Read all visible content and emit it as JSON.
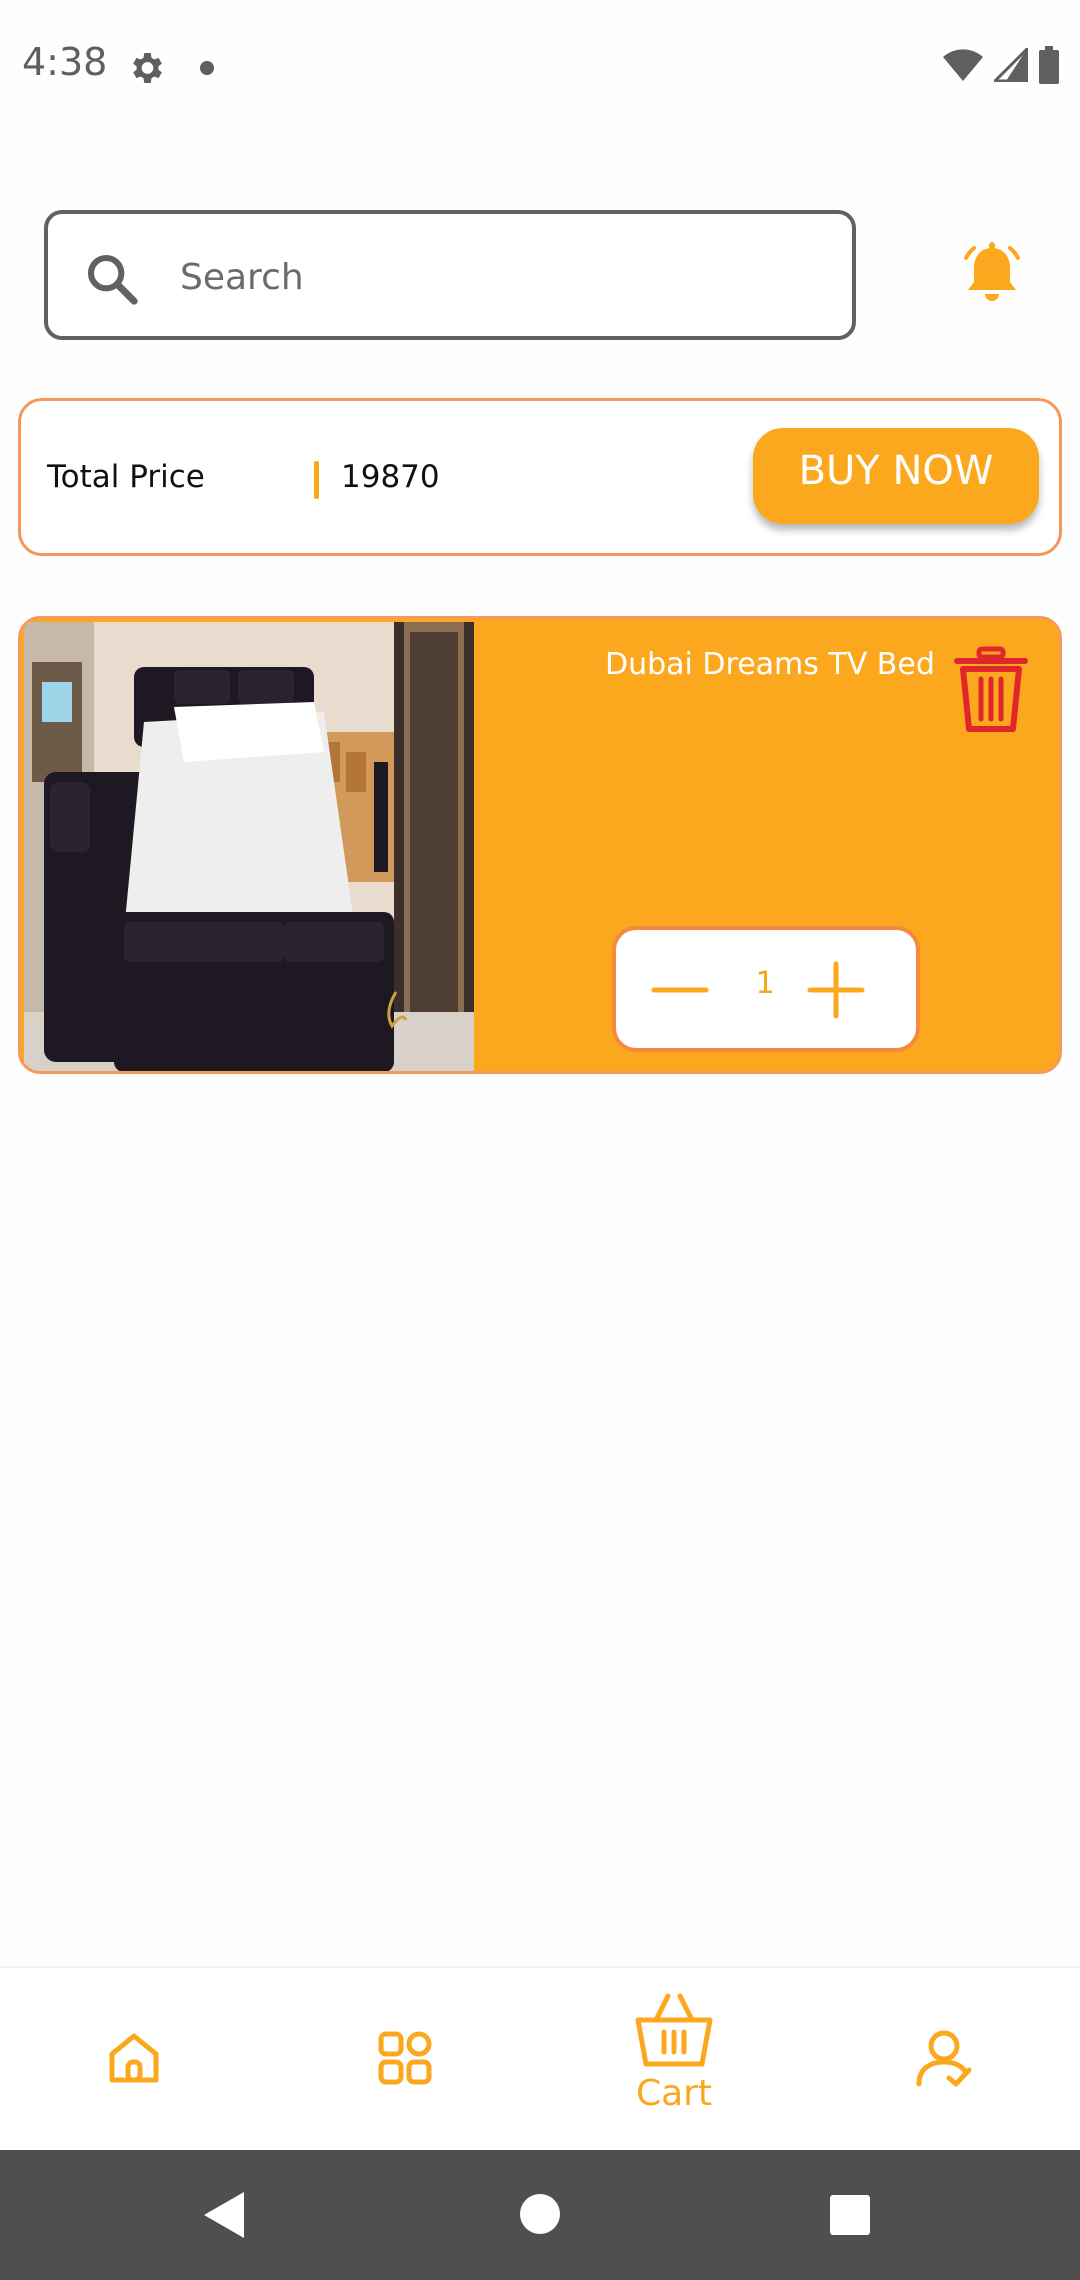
{
  "status_bar": {
    "time": "4:38"
  },
  "search": {
    "placeholder": "Search",
    "value": ""
  },
  "cart_summary": {
    "total_label": "Total Price",
    "total_value": "19870",
    "buy_button_label": "BUY NOW"
  },
  "cart_items": [
    {
      "name": "Dubai Dreams TV Bed",
      "quantity": "1"
    }
  ],
  "bottom_nav": {
    "items": [
      {
        "icon": "home-icon",
        "label": ""
      },
      {
        "icon": "categories-icon",
        "label": ""
      },
      {
        "icon": "cart-basket-icon",
        "label": "Cart",
        "active": true
      },
      {
        "icon": "profile-icon",
        "label": ""
      }
    ]
  },
  "colors": {
    "accent": "#fca81f",
    "card_border": "#f59a5c",
    "delete": "#e0262b",
    "system_nav": "#4f4f4f"
  }
}
